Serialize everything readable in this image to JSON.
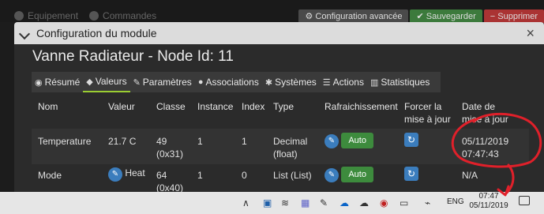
{
  "background": {
    "nav": [
      "Equipement",
      "Commandes"
    ],
    "actions": [
      "Configuration avancée",
      "Sauvegarder",
      "Supprimer"
    ]
  },
  "modal": {
    "header_title": "Configuration du module",
    "close": "×",
    "node_title": "Vanne Radiateur - Node Id: 11",
    "tabs": [
      {
        "label": "Résumé",
        "icon": "tachometer-icon"
      },
      {
        "label": "Valeurs",
        "icon": "tag-icon"
      },
      {
        "label": "Paramètres",
        "icon": "wrench-icon"
      },
      {
        "label": "Associations",
        "icon": "users-icon"
      },
      {
        "label": "Systèmes",
        "icon": "gears-icon"
      },
      {
        "label": "Actions",
        "icon": "sliders-icon"
      },
      {
        "label": "Statistiques",
        "icon": "bar-chart-icon"
      }
    ]
  },
  "table": {
    "headers": {
      "nom": "Nom",
      "valeur": "Valeur",
      "classe": "Classe",
      "instance": "Instance",
      "index": "Index",
      "type": "Type",
      "rafraichissement": "Rafraichissement",
      "forcer_1": "Forcer la",
      "forcer_2": "mise à jour",
      "date_1": "Date de",
      "date_2": "mise à jour"
    },
    "rows": [
      {
        "nom": "Temperature",
        "valeur": "21.7 C",
        "classe_1": "49",
        "classe_2": "(0x31)",
        "instance": "1",
        "index": "1",
        "type_1": "Decimal",
        "type_2": "(float)",
        "auto": "Auto",
        "date_1": "05/11/2019",
        "date_2": "07:47:43"
      },
      {
        "nom": "Mode",
        "valeur": "Heat",
        "classe_1": "64",
        "classe_2": "(0x40)",
        "instance": "1",
        "index": "0",
        "type_1": "List (List)",
        "auto": "Auto",
        "date_1": "N/A"
      }
    ]
  },
  "taskbar": {
    "lang": "ENG",
    "time": "07:47",
    "date": "05/11/2019"
  },
  "colors": {
    "annotation": "#e0202a",
    "accent_blue": "#3b7dbd",
    "auto_green": "#3d8b3d"
  }
}
